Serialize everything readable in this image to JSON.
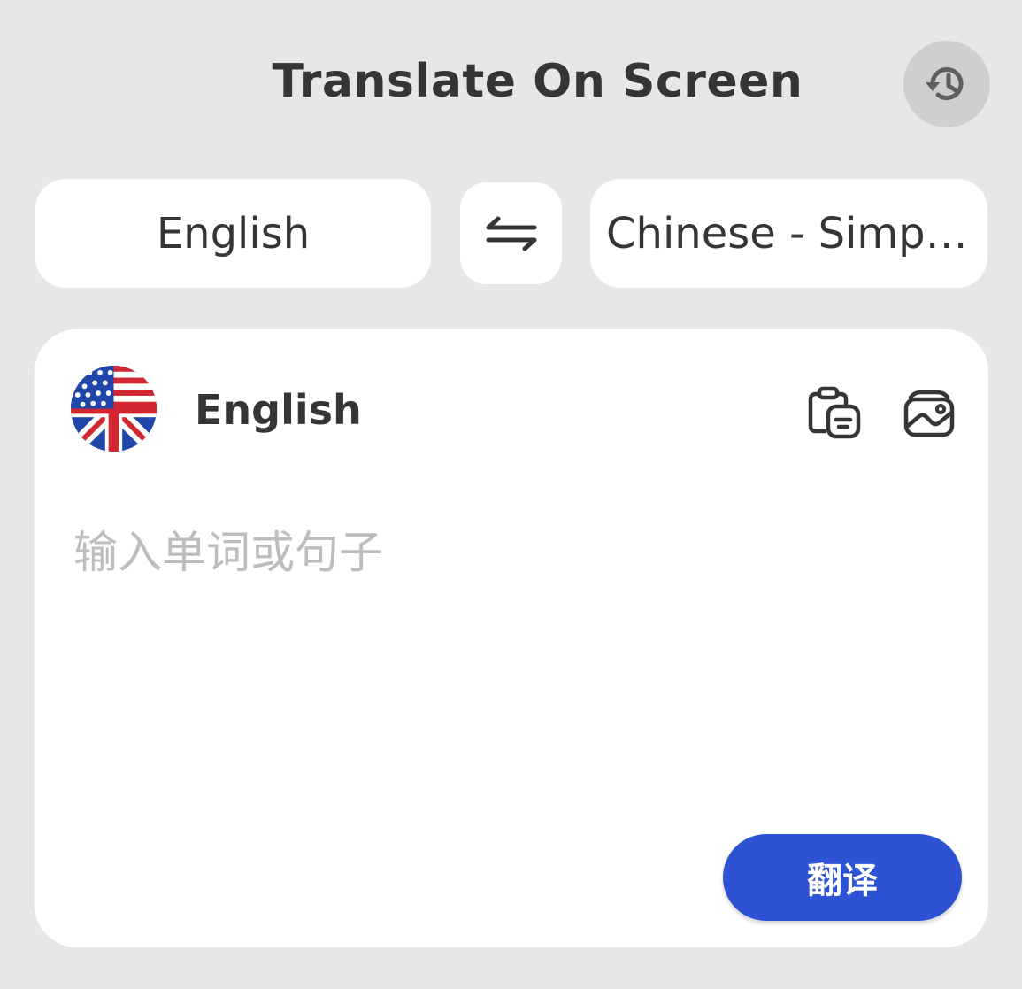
{
  "header": {
    "title": "Translate On Screen",
    "history_icon": "history-icon"
  },
  "language_bar": {
    "source_language": "English",
    "swap_icon": "swap-arrows-icon",
    "target_language": "Chinese - Simpli..."
  },
  "input_card": {
    "flag_icon": "us-uk-flag-icon",
    "language_label": "English",
    "paste_icon": "clipboard-paste-icon",
    "image_icon": "image-icon",
    "placeholder": "输入单词或句子",
    "value": "",
    "translate_label": "翻译"
  },
  "colors": {
    "background": "#e7e7e7",
    "card": "#ffffff",
    "accent": "#2d52d4",
    "text": "#353535",
    "placeholder": "#bdbdbd"
  }
}
